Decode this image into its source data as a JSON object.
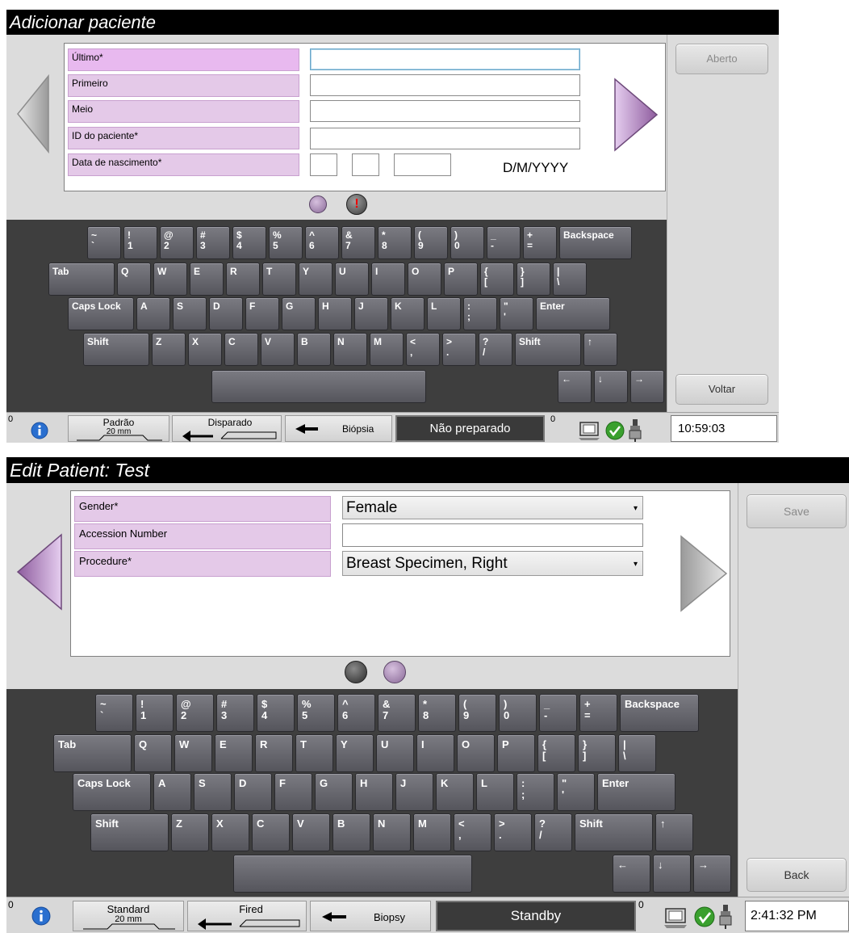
{
  "screen1": {
    "title": "Adicionar paciente",
    "fields": [
      {
        "label": "Último*",
        "value": ""
      },
      {
        "label": "Primeiro",
        "value": ""
      },
      {
        "label": "Meio",
        "value": ""
      },
      {
        "label": "ID do paciente*",
        "value": ""
      },
      {
        "label": "Data de nascimento*",
        "value": ""
      }
    ],
    "date_format": "D/M/YYYY",
    "right_buttons": {
      "top": "Aberto",
      "bottom": "Voltar"
    },
    "status": {
      "counter_left": "0",
      "paddle_top": "Padrão",
      "paddle_bottom": "20 mm",
      "fired": "Disparado",
      "biopsy": "Biópsia",
      "state": "Não preparado",
      "counter_right": "0",
      "clock": "10:59:03"
    }
  },
  "screen2": {
    "title": "Edit Patient: Test",
    "fields": [
      {
        "label": "Gender*",
        "value": "Female",
        "type": "select"
      },
      {
        "label": "Accession Number",
        "value": "",
        "type": "input"
      },
      {
        "label": "Procedure*",
        "value": "Breast Specimen, Right",
        "type": "select"
      }
    ],
    "right_buttons": {
      "top": "Save",
      "bottom": "Back"
    },
    "status": {
      "counter_left": "0",
      "paddle_top": "Standard",
      "paddle_bottom": "20 mm",
      "fired": "Fired",
      "biopsy": "Biopsy",
      "state": "Standby",
      "counter_right": "0",
      "clock": "2:41:32 PM"
    }
  },
  "keyboard": {
    "row1": [
      {
        "top": "~",
        "bottom": "`"
      },
      {
        "top": "!",
        "bottom": "1"
      },
      {
        "top": "@",
        "bottom": "2"
      },
      {
        "top": "#",
        "bottom": "3"
      },
      {
        "top": "$",
        "bottom": "4"
      },
      {
        "top": "%",
        "bottom": "5"
      },
      {
        "top": "^",
        "bottom": "6"
      },
      {
        "top": "&",
        "bottom": "7"
      },
      {
        "top": "*",
        "bottom": "8"
      },
      {
        "top": "(",
        "bottom": "9"
      },
      {
        "top": ")",
        "bottom": "0"
      },
      {
        "top": "_",
        "bottom": "-"
      },
      {
        "top": "+",
        "bottom": "="
      },
      {
        "top": "Backspace",
        "bottom": ""
      }
    ],
    "row2": [
      {
        "top": "Tab",
        "bottom": ""
      },
      {
        "top": "Q",
        "bottom": ""
      },
      {
        "top": "W",
        "bottom": ""
      },
      {
        "top": "E",
        "bottom": ""
      },
      {
        "top": "R",
        "bottom": ""
      },
      {
        "top": "T",
        "bottom": ""
      },
      {
        "top": "Y",
        "bottom": ""
      },
      {
        "top": "U",
        "bottom": ""
      },
      {
        "top": "I",
        "bottom": ""
      },
      {
        "top": "O",
        "bottom": ""
      },
      {
        "top": "P",
        "bottom": ""
      },
      {
        "top": "{",
        "bottom": "["
      },
      {
        "top": "}",
        "bottom": "]"
      },
      {
        "top": "|",
        "bottom": "\\"
      }
    ],
    "row3": [
      {
        "top": "Caps Lock",
        "bottom": ""
      },
      {
        "top": "A",
        "bottom": ""
      },
      {
        "top": "S",
        "bottom": ""
      },
      {
        "top": "D",
        "bottom": ""
      },
      {
        "top": "F",
        "bottom": ""
      },
      {
        "top": "G",
        "bottom": ""
      },
      {
        "top": "H",
        "bottom": ""
      },
      {
        "top": "J",
        "bottom": ""
      },
      {
        "top": "K",
        "bottom": ""
      },
      {
        "top": "L",
        "bottom": ""
      },
      {
        "top": ":",
        "bottom": ";"
      },
      {
        "top": "\"",
        "bottom": "'"
      },
      {
        "top": "Enter",
        "bottom": ""
      }
    ],
    "row4": [
      {
        "top": "Shift",
        "bottom": ""
      },
      {
        "top": "Z",
        "bottom": ""
      },
      {
        "top": "X",
        "bottom": ""
      },
      {
        "top": "C",
        "bottom": ""
      },
      {
        "top": "V",
        "bottom": ""
      },
      {
        "top": "B",
        "bottom": ""
      },
      {
        "top": "N",
        "bottom": ""
      },
      {
        "top": "M",
        "bottom": ""
      },
      {
        "top": "<",
        "bottom": ","
      },
      {
        "top": ">",
        "bottom": "."
      },
      {
        "top": "?",
        "bottom": "/"
      },
      {
        "top": "Shift",
        "bottom": ""
      },
      {
        "top": "↑",
        "bottom": ""
      }
    ],
    "row5": [
      {
        "top": "",
        "bottom": ""
      },
      {
        "top": "←",
        "bottom": ""
      },
      {
        "top": "↓",
        "bottom": ""
      },
      {
        "top": "→",
        "bottom": ""
      }
    ]
  },
  "colors": {
    "label_bg": "#e4c9e8",
    "keyboard_bg": "#3e3e3e",
    "key_bg": "#66666c",
    "arrow_purple": "#b89bc2",
    "arrow_gray": "#b5b5b5",
    "status_state_bg": "#3a3a3a"
  },
  "icons": {
    "info": "info-icon",
    "paddle": "paddle-icon",
    "fired_arrow": "fired-arrow-icon",
    "biopsy": "biopsy-icon",
    "workstation": "workstation-icon",
    "ok": "check-ok-icon",
    "tube": "xray-tube-icon"
  }
}
